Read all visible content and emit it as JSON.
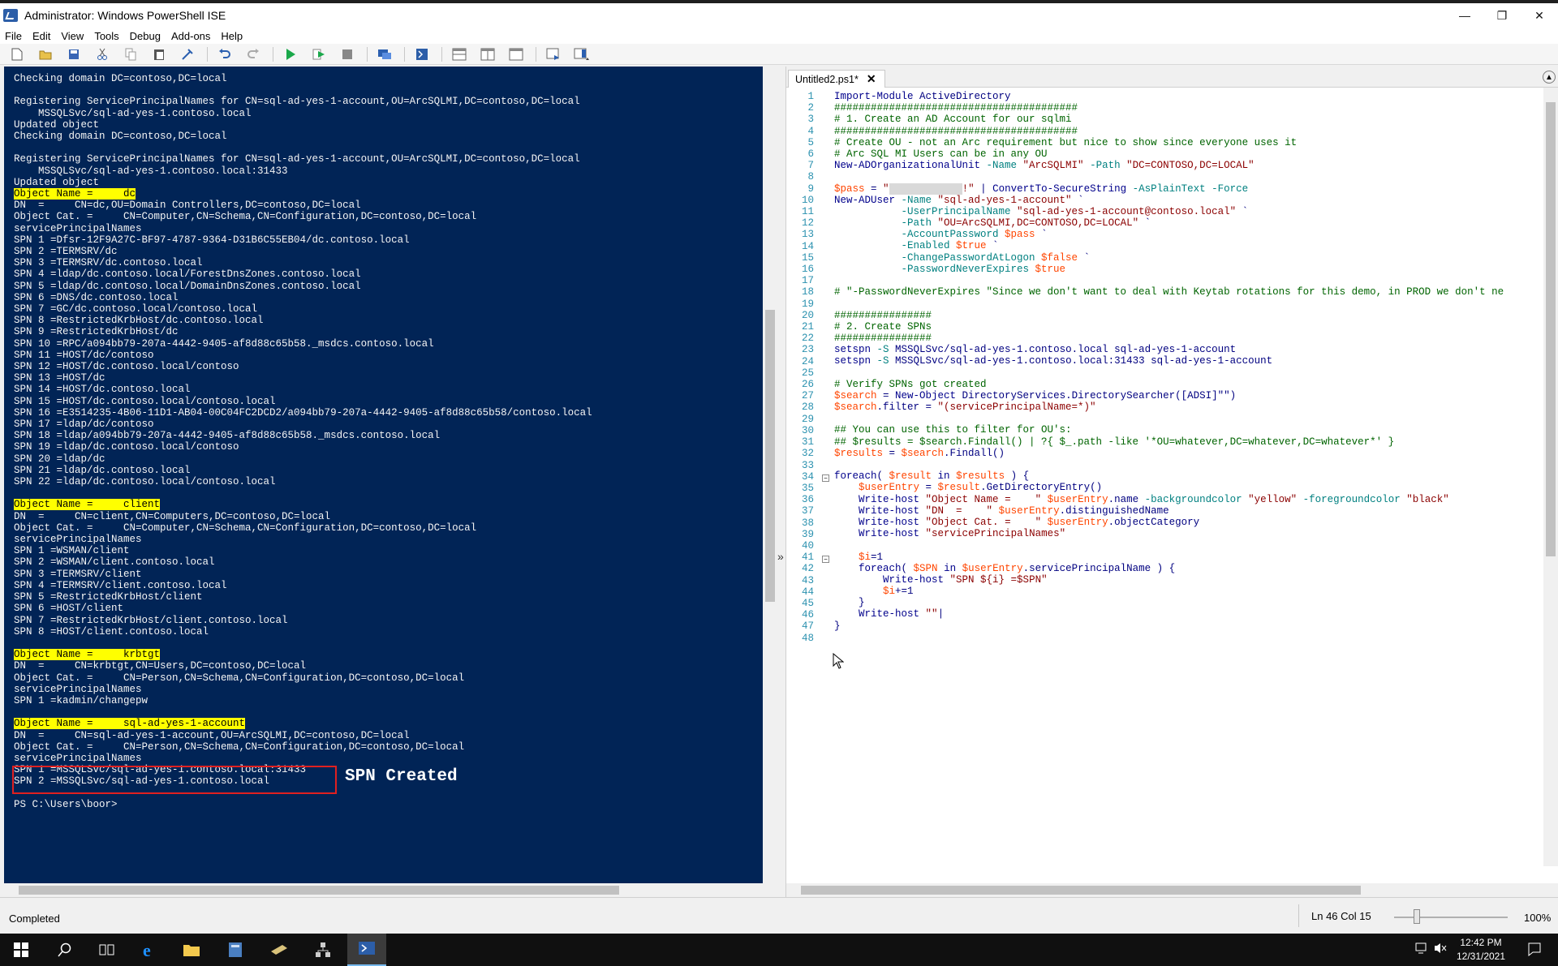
{
  "window": {
    "title": "Administrator: Windows PowerShell ISE",
    "minimize": "—",
    "maximize": "❐",
    "close": "✕"
  },
  "menu": [
    "File",
    "Edit",
    "View",
    "Tools",
    "Debug",
    "Add-ons",
    "Help"
  ],
  "toolbar_icons": [
    "new-icon",
    "open-icon",
    "save-icon",
    "cut-icon",
    "copy-icon",
    "paste-icon",
    "clear-icon",
    "undo-icon",
    "redo-icon",
    "run-icon",
    "run-selection-icon",
    "stop-icon",
    "remote-icon",
    "powershell-icon",
    "pane-top-icon",
    "pane-right-icon",
    "pane-max-icon",
    "script-pane-icon",
    "command-pane-icon"
  ],
  "console": {
    "lines": [
      {
        "t": "Checking domain DC=contoso,DC=local"
      },
      {
        "t": ""
      },
      {
        "t": "Registering ServicePrincipalNames for CN=sql-ad-yes-1-account,OU=ArcSQLMI,DC=contoso,DC=local"
      },
      {
        "t": "    MSSQLSvc/sql-ad-yes-1.contoso.local"
      },
      {
        "t": "Updated object"
      },
      {
        "t": "Checking domain DC=contoso,DC=local"
      },
      {
        "t": ""
      },
      {
        "t": "Registering ServicePrincipalNames for CN=sql-ad-yes-1-account,OU=ArcSQLMI,DC=contoso,DC=local"
      },
      {
        "t": "    MSSQLSvc/sql-ad-yes-1.contoso.local:31433"
      },
      {
        "t": "Updated object"
      },
      {
        "t": "Object Name =     dc",
        "hl": true
      },
      {
        "t": "DN  =     CN=dc,OU=Domain Controllers,DC=contoso,DC=local"
      },
      {
        "t": "Object Cat. =     CN=Computer,CN=Schema,CN=Configuration,DC=contoso,DC=local"
      },
      {
        "t": "servicePrincipalNames"
      },
      {
        "t": "SPN 1 =Dfsr-12F9A27C-BF97-4787-9364-D31B6C55EB04/dc.contoso.local"
      },
      {
        "t": "SPN 2 =TERMSRV/dc"
      },
      {
        "t": "SPN 3 =TERMSRV/dc.contoso.local"
      },
      {
        "t": "SPN 4 =ldap/dc.contoso.local/ForestDnsZones.contoso.local"
      },
      {
        "t": "SPN 5 =ldap/dc.contoso.local/DomainDnsZones.contoso.local"
      },
      {
        "t": "SPN 6 =DNS/dc.contoso.local"
      },
      {
        "t": "SPN 7 =GC/dc.contoso.local/contoso.local"
      },
      {
        "t": "SPN 8 =RestrictedKrbHost/dc.contoso.local"
      },
      {
        "t": "SPN 9 =RestrictedKrbHost/dc"
      },
      {
        "t": "SPN 10 =RPC/a094bb79-207a-4442-9405-af8d88c65b58._msdcs.contoso.local"
      },
      {
        "t": "SPN 11 =HOST/dc/contoso"
      },
      {
        "t": "SPN 12 =HOST/dc.contoso.local/contoso"
      },
      {
        "t": "SPN 13 =HOST/dc"
      },
      {
        "t": "SPN 14 =HOST/dc.contoso.local"
      },
      {
        "t": "SPN 15 =HOST/dc.contoso.local/contoso.local"
      },
      {
        "t": "SPN 16 =E3514235-4B06-11D1-AB04-00C04FC2DCD2/a094bb79-207a-4442-9405-af8d88c65b58/contoso.local"
      },
      {
        "t": "SPN 17 =ldap/dc/contoso"
      },
      {
        "t": "SPN 18 =ldap/a094bb79-207a-4442-9405-af8d88c65b58._msdcs.contoso.local"
      },
      {
        "t": "SPN 19 =ldap/dc.contoso.local/contoso"
      },
      {
        "t": "SPN 20 =ldap/dc"
      },
      {
        "t": "SPN 21 =ldap/dc.contoso.local"
      },
      {
        "t": "SPN 22 =ldap/dc.contoso.local/contoso.local"
      },
      {
        "t": ""
      },
      {
        "t": "Object Name =     client",
        "hl": true
      },
      {
        "t": "DN  =     CN=client,CN=Computers,DC=contoso,DC=local"
      },
      {
        "t": "Object Cat. =     CN=Computer,CN=Schema,CN=Configuration,DC=contoso,DC=local"
      },
      {
        "t": "servicePrincipalNames"
      },
      {
        "t": "SPN 1 =WSMAN/client"
      },
      {
        "t": "SPN 2 =WSMAN/client.contoso.local"
      },
      {
        "t": "SPN 3 =TERMSRV/client"
      },
      {
        "t": "SPN 4 =TERMSRV/client.contoso.local"
      },
      {
        "t": "SPN 5 =RestrictedKrbHost/client"
      },
      {
        "t": "SPN 6 =HOST/client"
      },
      {
        "t": "SPN 7 =RestrictedKrbHost/client.contoso.local"
      },
      {
        "t": "SPN 8 =HOST/client.contoso.local"
      },
      {
        "t": ""
      },
      {
        "t": "Object Name =     krbtgt",
        "hl": true
      },
      {
        "t": "DN  =     CN=krbtgt,CN=Users,DC=contoso,DC=local"
      },
      {
        "t": "Object Cat. =     CN=Person,CN=Schema,CN=Configuration,DC=contoso,DC=local"
      },
      {
        "t": "servicePrincipalNames"
      },
      {
        "t": "SPN 1 =kadmin/changepw"
      },
      {
        "t": ""
      },
      {
        "t": "Object Name =     sql-ad-yes-1-account",
        "hl": true
      },
      {
        "t": "DN  =     CN=sql-ad-yes-1-account,OU=ArcSQLMI,DC=contoso,DC=local"
      },
      {
        "t": "Object Cat. =     CN=Person,CN=Schema,CN=Configuration,DC=contoso,DC=local"
      },
      {
        "t": "servicePrincipalNames"
      },
      {
        "t": "SPN 1 =MSSQLSvc/sql-ad-yes-1.contoso.local:31433"
      },
      {
        "t": "SPN 2 =MSSQLSvc/sql-ad-yes-1.contoso.local"
      },
      {
        "t": ""
      },
      {
        "t": "PS C:\\Users\\boor>"
      }
    ],
    "annotation": "SPN Created"
  },
  "editor": {
    "tab_label": "Untitled2.ps1*",
    "tab_close": "✕",
    "line_count": 48,
    "code_lines": [
      [
        [
          "k",
          "Import-Module"
        ],
        [
          "p",
          " ActiveDirectory"
        ]
      ],
      [
        [
          "c",
          "########################################"
        ]
      ],
      [
        [
          "c",
          "# 1. Create an AD Account for our sqlmi"
        ]
      ],
      [
        [
          "c",
          "########################################"
        ]
      ],
      [
        [
          "c",
          "# Create OU - not an Arc requirement but nice to show since everyone uses it"
        ]
      ],
      [
        [
          "c",
          "# Arc SQL MI Users can be in any OU"
        ]
      ],
      [
        [
          "k",
          "New-ADOrganizationalUnit"
        ],
        [
          "t",
          " -Name "
        ],
        [
          "s",
          "\"ArcSQLMI\""
        ],
        [
          "t",
          " -Path "
        ],
        [
          "s",
          "\"DC=CONTOSO,DC=LOCAL\""
        ]
      ],
      [
        [
          "p",
          ""
        ]
      ],
      [
        [
          "v",
          "$pass"
        ],
        [
          "p",
          " = "
        ],
        [
          "s",
          "\""
        ],
        [
          "blur",
          "XXXXXXXXXXXX"
        ],
        [
          "s",
          "!\""
        ],
        [
          "p",
          " | "
        ],
        [
          "k",
          "ConvertTo-SecureString"
        ],
        [
          "t",
          " -AsPlainText -Force"
        ]
      ],
      [
        [
          "k",
          "New-ADUser"
        ],
        [
          "t",
          " -Name "
        ],
        [
          "s",
          "\"sql-ad-yes-1-account\""
        ],
        [
          "p",
          " `"
        ]
      ],
      [
        [
          "t",
          "           -UserPrincipalName "
        ],
        [
          "s",
          "\"sql-ad-yes-1-account@contoso.local\""
        ],
        [
          "p",
          " `"
        ]
      ],
      [
        [
          "t",
          "           -Path "
        ],
        [
          "s",
          "\"OU=ArcSQLMI,DC=CONTOSO,DC=LOCAL\""
        ],
        [
          "p",
          " `"
        ]
      ],
      [
        [
          "t",
          "           -AccountPassword "
        ],
        [
          "v",
          "$pass"
        ],
        [
          "p",
          " `"
        ]
      ],
      [
        [
          "t",
          "           -Enabled "
        ],
        [
          "v",
          "$true"
        ],
        [
          "p",
          " `"
        ]
      ],
      [
        [
          "t",
          "           -ChangePasswordAtLogon "
        ],
        [
          "v",
          "$false"
        ],
        [
          "p",
          " `"
        ]
      ],
      [
        [
          "t",
          "           -PasswordNeverExpires "
        ],
        [
          "v",
          "$true"
        ]
      ],
      [
        [
          "p",
          ""
        ]
      ],
      [
        [
          "c",
          "# \"-PasswordNeverExpires \"Since we don't want to deal with Keytab rotations for this demo, in PROD we don't ne"
        ]
      ],
      [
        [
          "p",
          ""
        ]
      ],
      [
        [
          "c",
          "################"
        ]
      ],
      [
        [
          "c",
          "# 2. Create SPNs"
        ]
      ],
      [
        [
          "c",
          "################"
        ]
      ],
      [
        [
          "k",
          "setspn"
        ],
        [
          "t",
          " -S "
        ],
        [
          "p",
          "MSSQLSvc/sql-ad-yes-1.contoso.local sql-ad-yes-1-account"
        ]
      ],
      [
        [
          "k",
          "setspn"
        ],
        [
          "t",
          " -S "
        ],
        [
          "p",
          "MSSQLSvc/sql-ad-yes-1.contoso.local:31433 sql-ad-yes-1-account"
        ]
      ],
      [
        [
          "p",
          ""
        ]
      ],
      [
        [
          "c",
          "# Verify SPNs got created"
        ]
      ],
      [
        [
          "v",
          "$search"
        ],
        [
          "p",
          " = "
        ],
        [
          "k",
          "New-Object"
        ],
        [
          "p",
          " DirectoryServices.DirectorySearcher([ADSI]\"\")"
        ]
      ],
      [
        [
          "v",
          "$search"
        ],
        [
          "p",
          ".filter = "
        ],
        [
          "s",
          "\"(servicePrincipalName=*)\""
        ]
      ],
      [
        [
          "p",
          ""
        ]
      ],
      [
        [
          "c",
          "## You can use this to filter for OU's:"
        ]
      ],
      [
        [
          "c",
          "## $results = $search.Findall() | ?{ $_.path -like '*OU=whatever,DC=whatever,DC=whatever*' }"
        ]
      ],
      [
        [
          "v",
          "$results"
        ],
        [
          "p",
          " = "
        ],
        [
          "v",
          "$search"
        ],
        [
          "p",
          ".Findall()"
        ]
      ],
      [
        [
          "p",
          ""
        ]
      ],
      [
        [
          "k",
          "foreach"
        ],
        [
          "p",
          "( "
        ],
        [
          "v",
          "$result"
        ],
        [
          "k",
          " in "
        ],
        [
          "v",
          "$results"
        ],
        [
          "p",
          " ) {"
        ]
      ],
      [
        [
          "p",
          "    "
        ],
        [
          "v",
          "$userEntry"
        ],
        [
          "p",
          " = "
        ],
        [
          "v",
          "$result"
        ],
        [
          "p",
          ".GetDirectoryEntry()"
        ]
      ],
      [
        [
          "p",
          "    "
        ],
        [
          "k",
          "Write-host"
        ],
        [
          "p",
          " "
        ],
        [
          "s",
          "\"Object Name =    \""
        ],
        [
          "p",
          " "
        ],
        [
          "v",
          "$userEntry"
        ],
        [
          "p",
          ".name "
        ],
        [
          "t",
          "-backgroundcolor "
        ],
        [
          "s",
          "\"yellow\""
        ],
        [
          "t",
          " -foregroundcolor "
        ],
        [
          "s",
          "\"black\""
        ]
      ],
      [
        [
          "p",
          "    "
        ],
        [
          "k",
          "Write-host"
        ],
        [
          "p",
          " "
        ],
        [
          "s",
          "\"DN  =    \""
        ],
        [
          "p",
          " "
        ],
        [
          "v",
          "$userEntry"
        ],
        [
          "p",
          ".distinguishedName"
        ]
      ],
      [
        [
          "p",
          "    "
        ],
        [
          "k",
          "Write-host"
        ],
        [
          "p",
          " "
        ],
        [
          "s",
          "\"Object Cat. =    \""
        ],
        [
          "p",
          " "
        ],
        [
          "v",
          "$userEntry"
        ],
        [
          "p",
          ".objectCategory"
        ]
      ],
      [
        [
          "p",
          "    "
        ],
        [
          "k",
          "Write-host"
        ],
        [
          "p",
          " "
        ],
        [
          "s",
          "\"servicePrincipalNames\""
        ]
      ],
      [
        [
          "p",
          ""
        ]
      ],
      [
        [
          "p",
          "    "
        ],
        [
          "v",
          "$i"
        ],
        [
          "p",
          "=1"
        ]
      ],
      [
        [
          "p",
          "    "
        ],
        [
          "k",
          "foreach"
        ],
        [
          "p",
          "( "
        ],
        [
          "v",
          "$SPN"
        ],
        [
          "k",
          " in "
        ],
        [
          "v",
          "$userEntry"
        ],
        [
          "p",
          ".servicePrincipalName ) {"
        ]
      ],
      [
        [
          "p",
          "        "
        ],
        [
          "k",
          "Write-host"
        ],
        [
          "p",
          " "
        ],
        [
          "s",
          "\"SPN ${i} =$SPN\""
        ]
      ],
      [
        [
          "p",
          "        "
        ],
        [
          "v",
          "$i"
        ],
        [
          "p",
          "+=1"
        ]
      ],
      [
        [
          "p",
          "    }"
        ]
      ],
      [
        [
          "p",
          "    "
        ],
        [
          "k",
          "Write-host"
        ],
        [
          "p",
          " "
        ],
        [
          "s",
          "\"\""
        ],
        [
          "p",
          "|"
        ]
      ],
      [
        [
          "p",
          "}"
        ]
      ],
      [
        [
          "p",
          ""
        ]
      ]
    ]
  },
  "status": {
    "text": "Completed",
    "position": "Ln 46  Col 15",
    "zoom": "100%",
    "zoom_level": 0.17
  },
  "taskbar": {
    "time": "12:42 PM",
    "date": "12/31/2021"
  }
}
